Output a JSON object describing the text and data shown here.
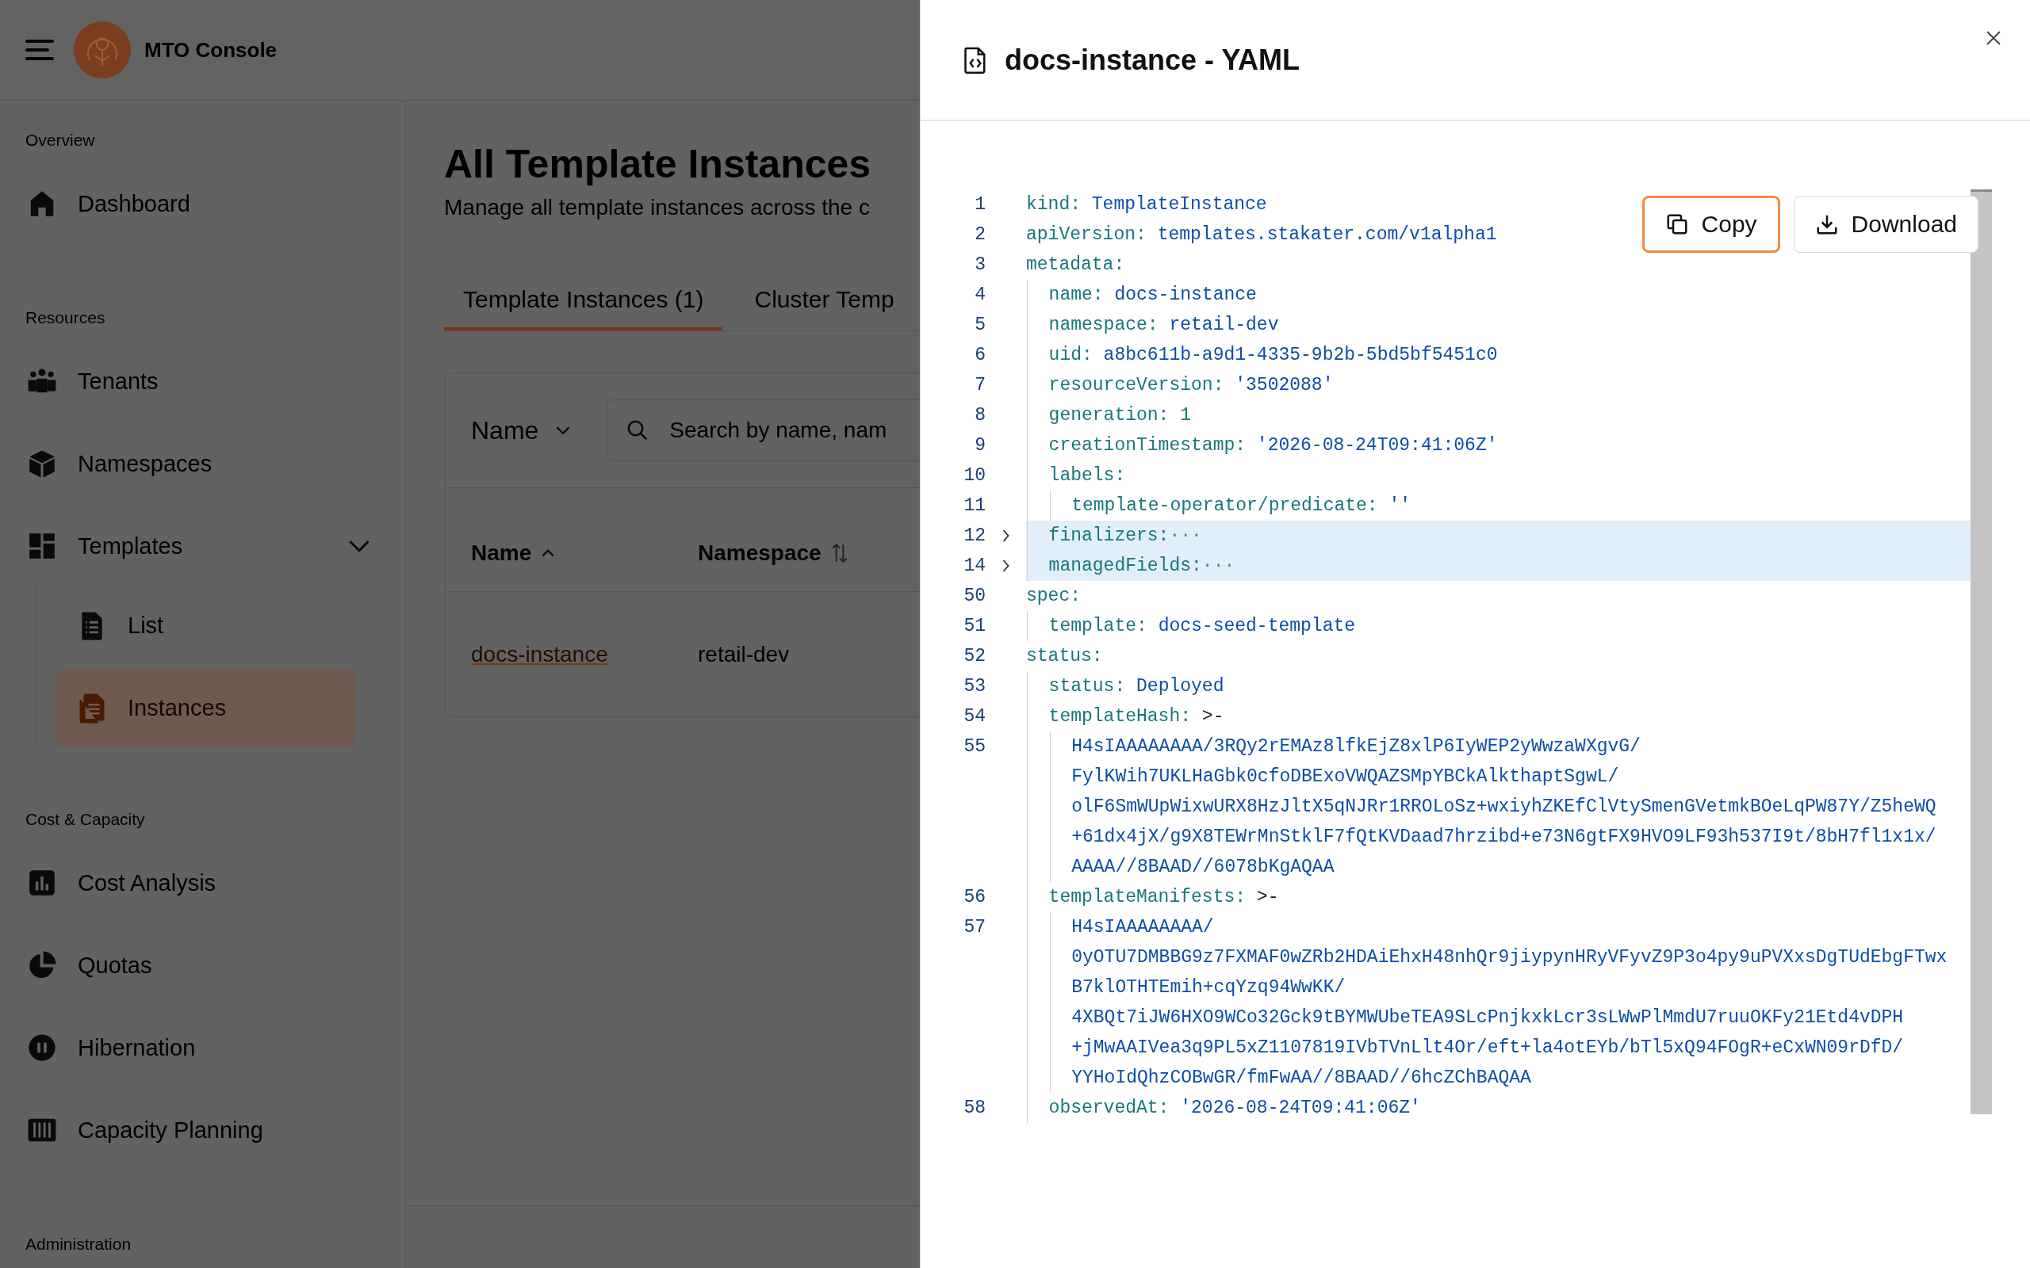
{
  "app": {
    "title": "MTO Console"
  },
  "sidebar": {
    "sections": [
      {
        "heading": "Overview",
        "items": [
          {
            "label": "Dashboard",
            "selected": false
          }
        ]
      },
      {
        "heading": "Resources",
        "items": [
          {
            "label": "Tenants",
            "selected": false
          },
          {
            "label": "Namespaces",
            "selected": false
          },
          {
            "label": "Templates",
            "selected": false,
            "expanded": true,
            "children": [
              {
                "label": "List",
                "selected": false
              },
              {
                "label": "Instances",
                "selected": true
              }
            ]
          }
        ]
      },
      {
        "heading": "Cost & Capacity",
        "items": [
          {
            "label": "Cost Analysis",
            "selected": false
          },
          {
            "label": "Quotas",
            "selected": false
          },
          {
            "label": "Hibernation",
            "selected": false
          },
          {
            "label": "Capacity Planning",
            "selected": false
          }
        ]
      },
      {
        "heading": "Administration"
      }
    ]
  },
  "page": {
    "title": "All Template Instances",
    "subtitle": "Manage all template instances across the c",
    "tabs": [
      {
        "label": "Template Instances (1)",
        "selected": true
      },
      {
        "label": "Cluster Temp",
        "selected": false
      }
    ],
    "filter": {
      "field": "Name",
      "placeholder": "Search by name, nam"
    },
    "table": {
      "columns": [
        {
          "label": "Name",
          "sorted": true
        },
        {
          "label": "Namespace",
          "sorted": false
        }
      ],
      "rows": [
        [
          "docs-instance",
          "retail-dev"
        ]
      ]
    }
  },
  "drawer": {
    "title": "docs-instance - YAML",
    "buttons": [
      {
        "label": "Copy",
        "focused": true
      },
      {
        "label": "Download",
        "focused": false
      }
    ],
    "lines": [
      {
        "number": "1",
        "key": "kind:",
        "value": "TemplateInstance",
        "kind": "string",
        "collapsed": false
      },
      {
        "number": "2",
        "key": "apiVersion:",
        "value": "templates.stakater.com/v1alpha1",
        "kind": "string",
        "collapsed": false
      },
      {
        "number": "3",
        "key": "metadata:",
        "collapsed": false,
        "children": [
          {
            "number": "4",
            "key": "name:",
            "value": "docs-instance",
            "kind": "string",
            "collapsed": false
          },
          {
            "number": "5",
            "key": "namespace:",
            "value": "retail-dev",
            "kind": "string",
            "collapsed": false
          },
          {
            "number": "6",
            "key": "uid:",
            "value": "a8bc611b-a9d1-4335-9b2b-5bd5bf5451c0",
            "kind": "string",
            "collapsed": false
          },
          {
            "number": "7",
            "key": "resourceVersion:",
            "value": "'3502088'",
            "kind": "string",
            "collapsed": false
          },
          {
            "number": "8",
            "key": "generation:",
            "value": "1",
            "kind": "number",
            "collapsed": false
          },
          {
            "number": "9",
            "key": "creationTimestamp:",
            "value": "'2026-08-24T09:41:06Z'",
            "kind": "string",
            "collapsed": false
          },
          {
            "number": "10",
            "key": "labels:",
            "collapsed": false,
            "children": [
              {
                "number": "11",
                "key": "template-operator/predicate:",
                "value": "''",
                "kind": "string",
                "collapsed": false
              }
            ]
          },
          {
            "number": "12",
            "key": "finalizers:",
            "value": "···",
            "kind": "fold",
            "collapsed": true
          },
          {
            "number": "14",
            "key": "managedFields:",
            "value": "···",
            "kind": "fold",
            "collapsed": true
          }
        ]
      },
      {
        "number": "50",
        "key": "spec:",
        "collapsed": false,
        "children": [
          {
            "number": "51",
            "key": "template:",
            "value": "docs-seed-template",
            "kind": "string",
            "collapsed": false
          }
        ]
      },
      {
        "number": "52",
        "key": "status:",
        "collapsed": false,
        "children": [
          {
            "number": "53",
            "key": "status:",
            "value": "Deployed",
            "kind": "string",
            "collapsed": false
          },
          {
            "number": "54",
            "key": "templateHash:",
            "value": ">-",
            "kind": "plain",
            "collapsed": false,
            "children": [
              {
                "number": "55",
                "collapsed": false,
                "kind": "string",
                "wrap": [
                  "H4sIAAAAAAAA/3RQy2rEMAz8lfkEjZ8xlP6IyWEP2yWwzaWXgvG/",
                  "FylKWih7UKLHaGbk0cfoDBExoVWQAZSMpYBCkAlkthaptSgwL/",
                  "olF6SmWUpWixwURX8HzJltX5qNJRr1RROLoSz+wxiyhZKEfClVtySmenGVetmkBOeLqPW87Y/Z5heWQ",
                  "+61dx4jX/g9X8TEWrMnStklF7fQtKVDaad7hrzibd+e73N6gtFX9HVO9LF93h537I9t/8bH7fl1x1x/",
                  "AAAA//8BAAD//6078bKgAQAA"
                ]
              }
            ]
          },
          {
            "number": "56",
            "key": "templateManifests:",
            "value": ">-",
            "kind": "plain",
            "collapsed": false,
            "children": [
              {
                "number": "57",
                "collapsed": false,
                "kind": "string",
                "wrap": [
                  "H4sIAAAAAAAA/",
                  "0yOTU7DMBBG9z7FXMAF0wZRb2HDAiEhxH48nhQr9jiypynHRyVFyvZ9P3o4py9uPVXxsDgTUdEbgFTwx",
                  "B7klOTHTEmih+cqYzq94WwKK/",
                  "4XBQt7iJW6HXO9WCo32Gck9tBYMWUbeTEA9SLcPnjkxkLcr3sLWwPlMmdU7ruuOKFy21Etd4vDPH",
                  "+jMwAAIVea3q9PL5xZ1107819IVbTVnLlt4Or/eft+la4otEYb/bTl5xQ94FOgR+eCxWN09rDfD/",
                  "YYHoIdQhzCOBwGR/fmFwAA//8BAAD//6hcZChBAQAA"
                ]
              }
            ]
          },
          {
            "number": "58",
            "key": "observedAt:",
            "value": "'2026-08-24T09:41:06Z'",
            "kind": "string",
            "collapsed": false
          }
        ]
      }
    ]
  }
}
